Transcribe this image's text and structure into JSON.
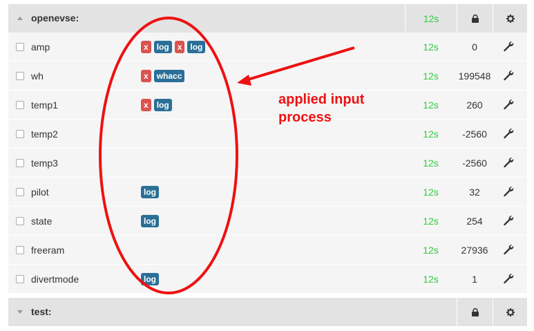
{
  "nodes": [
    {
      "name": "openevse:",
      "time": "12s",
      "expanded": true,
      "inputs": [
        {
          "name": "amp",
          "processes": [
            {
              "label": "x",
              "color": "red"
            },
            {
              "label": "log",
              "color": "blue"
            },
            {
              "label": "x",
              "color": "red"
            },
            {
              "label": "log",
              "color": "blue"
            }
          ],
          "time": "12s",
          "value": "0"
        },
        {
          "name": "wh",
          "processes": [
            {
              "label": "x",
              "color": "red"
            },
            {
              "label": "whacc",
              "color": "blue"
            }
          ],
          "time": "12s",
          "value": "199548"
        },
        {
          "name": "temp1",
          "processes": [
            {
              "label": "x",
              "color": "red"
            },
            {
              "label": "log",
              "color": "blue"
            }
          ],
          "time": "12s",
          "value": "260"
        },
        {
          "name": "temp2",
          "processes": [],
          "time": "12s",
          "value": "-2560"
        },
        {
          "name": "temp3",
          "processes": [],
          "time": "12s",
          "value": "-2560"
        },
        {
          "name": "pilot",
          "processes": [
            {
              "label": "log",
              "color": "blue"
            }
          ],
          "time": "12s",
          "value": "32"
        },
        {
          "name": "state",
          "processes": [
            {
              "label": "log",
              "color": "blue"
            }
          ],
          "time": "12s",
          "value": "254"
        },
        {
          "name": "freeram",
          "processes": [],
          "time": "12s",
          "value": "27936"
        },
        {
          "name": "divertmode",
          "processes": [
            {
              "label": "log",
              "color": "blue"
            }
          ],
          "time": "12s",
          "value": "1"
        }
      ]
    },
    {
      "name": "test:",
      "time": "",
      "expanded": false,
      "inputs": []
    }
  ],
  "annotation": {
    "line1": "applied input",
    "line2": "process",
    "color": "#ee1111"
  },
  "icons": {
    "lock": "lock-icon",
    "gear": "gear-icon",
    "wrench": "wrench-icon"
  },
  "colors": {
    "time_green": "#2ecc40",
    "badge_red": "#d9534f",
    "badge_blue": "#2a6f97"
  }
}
